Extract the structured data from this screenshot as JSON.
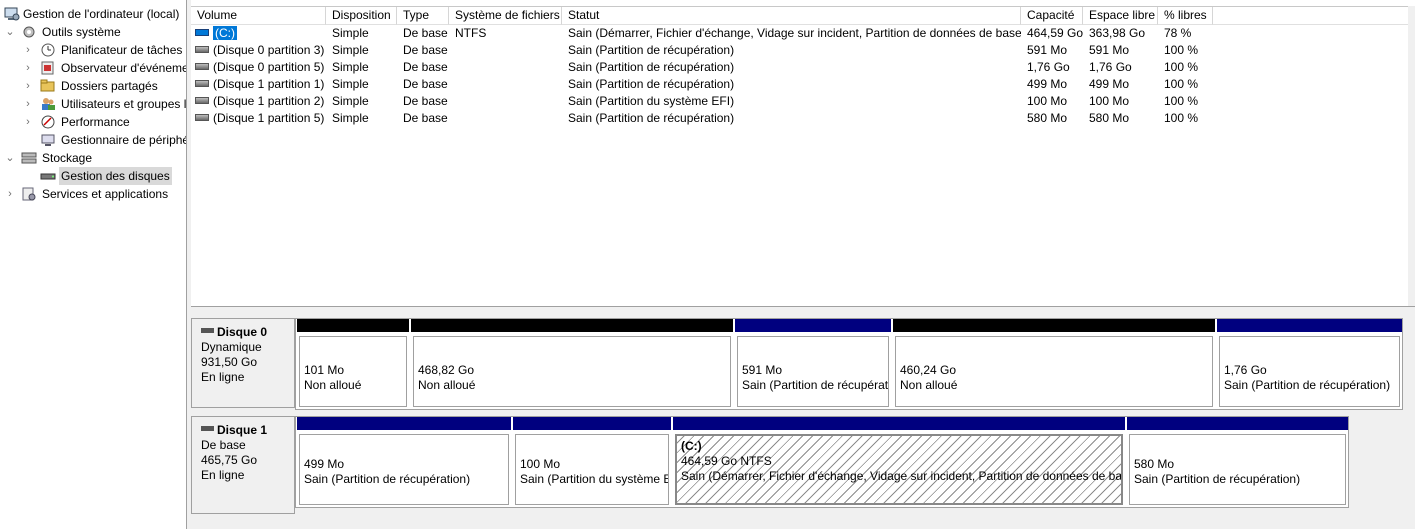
{
  "tree": {
    "items": [
      {
        "label": "Gestion de l'ordinateur (local)",
        "icon": "computer-management-icon"
      },
      {
        "label": "Outils système",
        "icon": "system-tools-icon"
      },
      {
        "label": "Planificateur de tâches",
        "icon": "task-scheduler-icon"
      },
      {
        "label": "Observateur d'événeme",
        "icon": "event-viewer-icon"
      },
      {
        "label": "Dossiers partagés",
        "icon": "shared-folders-icon"
      },
      {
        "label": "Utilisateurs et groupes l",
        "icon": "users-groups-icon"
      },
      {
        "label": "Performance",
        "icon": "performance-icon"
      },
      {
        "label": "Gestionnaire de périphé",
        "icon": "device-manager-icon"
      },
      {
        "label": "Stockage",
        "icon": "storage-icon"
      },
      {
        "label": "Gestion des disques",
        "icon": "disk-management-icon"
      },
      {
        "label": "Services et applications",
        "icon": "services-applications-icon"
      }
    ]
  },
  "table": {
    "columns": [
      "Volume",
      "Disposition",
      "Type",
      "Système de fichiers",
      "Statut",
      "Capacité",
      "Espace libre",
      "% libres"
    ],
    "rows": [
      {
        "volume": "(C:)",
        "layout": "Simple",
        "type": "De base",
        "fs": "NTFS",
        "status": "Sain (Démarrer, Fichier d'échange, Vidage sur incident, Partition de données de base)",
        "capacity": "464,59 Go",
        "free": "363,98 Go",
        "pct": "78 %"
      },
      {
        "volume": "(Disque 0 partition 3)",
        "layout": "Simple",
        "type": "De base",
        "fs": "",
        "status": "Sain (Partition de récupération)",
        "capacity": "591 Mo",
        "free": "591 Mo",
        "pct": "100 %"
      },
      {
        "volume": "(Disque 0 partition 5)",
        "layout": "Simple",
        "type": "De base",
        "fs": "",
        "status": "Sain (Partition de récupération)",
        "capacity": "1,76 Go",
        "free": "1,76 Go",
        "pct": "100 %"
      },
      {
        "volume": "(Disque 1 partition 1)",
        "layout": "Simple",
        "type": "De base",
        "fs": "",
        "status": "Sain (Partition de récupération)",
        "capacity": "499 Mo",
        "free": "499 Mo",
        "pct": "100 %"
      },
      {
        "volume": "(Disque 1 partition 2)",
        "layout": "Simple",
        "type": "De base",
        "fs": "",
        "status": "Sain (Partition du système EFI)",
        "capacity": "100 Mo",
        "free": "100 Mo",
        "pct": "100 %"
      },
      {
        "volume": "(Disque 1 partition 5)",
        "layout": "Simple",
        "type": "De base",
        "fs": "",
        "status": "Sain (Partition de récupération)",
        "capacity": "580 Mo",
        "free": "580 Mo",
        "pct": "100 %"
      }
    ]
  },
  "disks": [
    {
      "name": "Disque 0",
      "kind": "Dynamique",
      "size": "931,50 Go",
      "state": "En ligne",
      "partitions": [
        {
          "line1": "",
          "line2": "101 Mo",
          "line3": "Non alloué",
          "bar": "black"
        },
        {
          "line1": "",
          "line2": "468,82 Go",
          "line3": "Non alloué",
          "bar": "black"
        },
        {
          "line1": "",
          "line2": "591 Mo",
          "line3": "Sain (Partition de récupérat",
          "bar": "blue"
        },
        {
          "line1": "",
          "line2": "460,24 Go",
          "line3": "Non alloué",
          "bar": "black"
        },
        {
          "line1": "",
          "line2": "1,76 Go",
          "line3": "Sain (Partition de récupération)",
          "bar": "blue"
        }
      ]
    },
    {
      "name": "Disque 1",
      "kind": "De base",
      "size": "465,75 Go",
      "state": "En ligne",
      "partitions": [
        {
          "line1": "",
          "line2": "499 Mo",
          "line3": "Sain (Partition de récupération)",
          "bar": "blue"
        },
        {
          "line1": "",
          "line2": "100 Mo",
          "line3": "Sain (Partition du système E",
          "bar": "blue"
        },
        {
          "line1": "(C:)",
          "line2": "464,59 Go NTFS",
          "line3": "Sain (Démarrer, Fichier d'échange, Vidage sur incident, Partition de données de base)",
          "bar": "blue"
        },
        {
          "line1": "",
          "line2": "580 Mo",
          "line3": "Sain (Partition de récupération)",
          "bar": "blue"
        }
      ]
    }
  ]
}
